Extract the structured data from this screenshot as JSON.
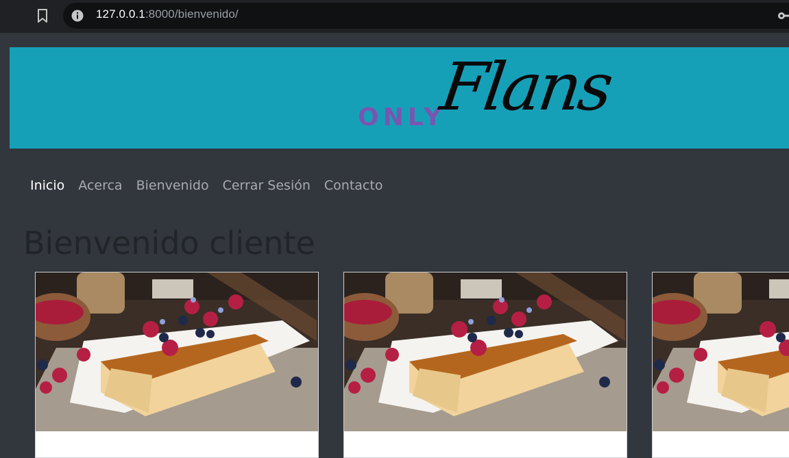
{
  "browser": {
    "url_host": "127.0.0.1",
    "url_rest": ":8000/bienvenido/"
  },
  "header": {
    "logo_only": "ONLY",
    "logo_flans": "Flans"
  },
  "nav": {
    "items": [
      {
        "label": "Inicio",
        "active": true
      },
      {
        "label": "Acerca",
        "active": false
      },
      {
        "label": "Bienvenido",
        "active": false
      },
      {
        "label": "Cerrar Sesión",
        "active": false
      },
      {
        "label": "Contacto",
        "active": false
      }
    ]
  },
  "main": {
    "title": "Bienvenido cliente"
  },
  "colors": {
    "banner": "#16a0b8",
    "page_bg": "#32363d",
    "logo_only": "#7a55b0"
  },
  "icons": [
    "bookmark-icon",
    "info-icon",
    "key-icon"
  ]
}
